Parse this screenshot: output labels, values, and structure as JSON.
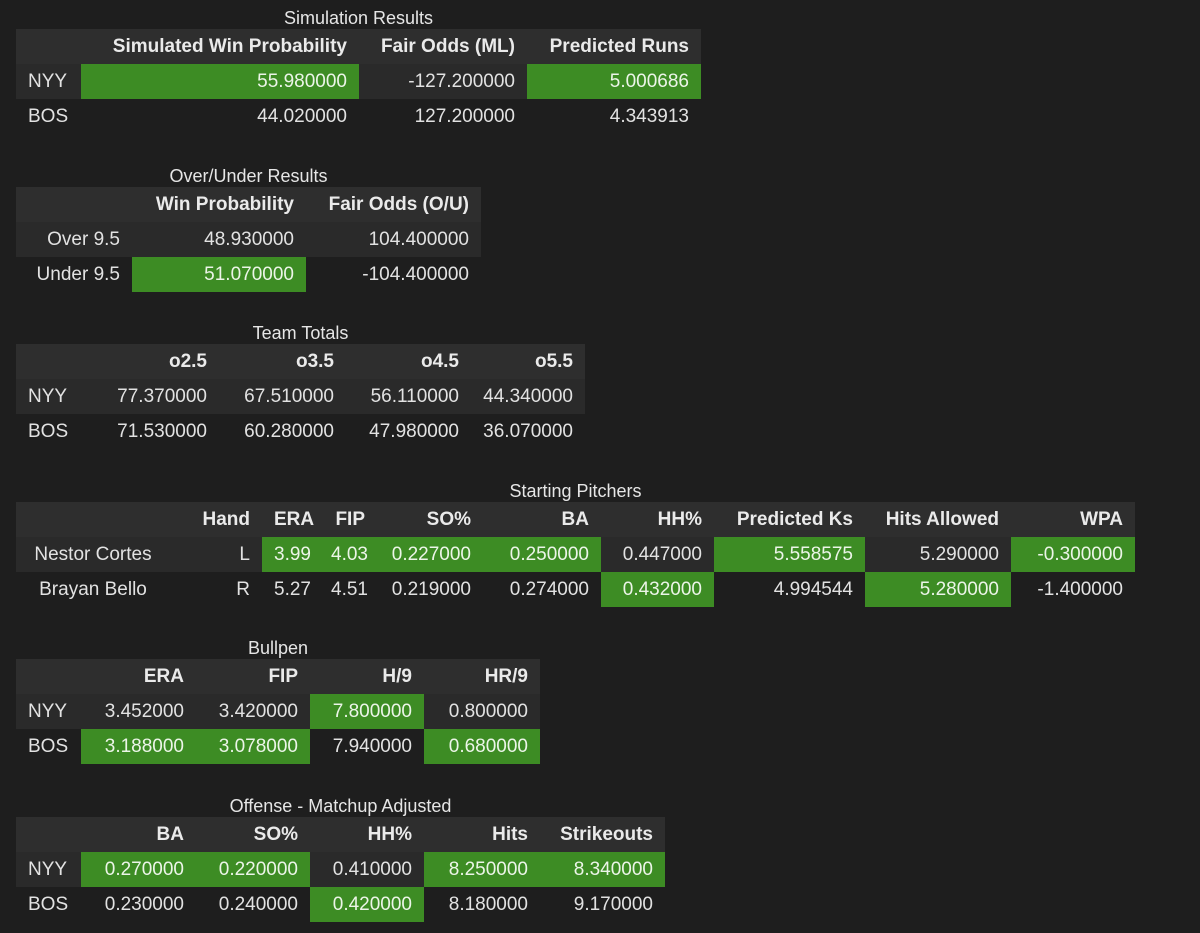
{
  "colors": {
    "background": "#1e1e1e",
    "header_bg": "#2e2e2e",
    "stripe_bg": "#2a2a2a",
    "highlight": "#3d8c24",
    "text": "#e2e2e2"
  },
  "simulation": {
    "caption": "Simulation Results",
    "headers": [
      "",
      "Simulated Win Probability",
      "Fair Odds (ML)",
      "Predicted Runs"
    ],
    "rows": [
      {
        "cells": [
          "NYY",
          "55.980000",
          "-127.200000",
          "5.000686"
        ],
        "highlight": [
          false,
          true,
          false,
          true
        ]
      },
      {
        "cells": [
          "BOS",
          "44.020000",
          "127.200000",
          "4.343913"
        ],
        "highlight": [
          false,
          false,
          false,
          false
        ]
      }
    ]
  },
  "over_under": {
    "caption": "Over/Under Results",
    "headers": [
      "",
      "Win Probability",
      "Fair Odds (O/U)"
    ],
    "rows": [
      {
        "cells": [
          "Over 9.5",
          "48.930000",
          "104.400000"
        ],
        "highlight": [
          false,
          false,
          false
        ]
      },
      {
        "cells": [
          "Under 9.5",
          "51.070000",
          "-104.400000"
        ],
        "highlight": [
          false,
          true,
          false
        ]
      }
    ]
  },
  "team_totals": {
    "caption": "Team Totals",
    "headers": [
      "",
      "o2.5",
      "o3.5",
      "o4.5",
      "o5.5"
    ],
    "rows": [
      {
        "cells": [
          "NYY",
          "77.370000",
          "67.510000",
          "56.110000",
          "44.340000"
        ],
        "highlight": [
          false,
          false,
          false,
          false,
          false
        ]
      },
      {
        "cells": [
          "BOS",
          "71.530000",
          "60.280000",
          "47.980000",
          "36.070000"
        ],
        "highlight": [
          false,
          false,
          false,
          false,
          false
        ]
      }
    ]
  },
  "starting_pitchers": {
    "caption": "Starting Pitchers",
    "headers": [
      "",
      "Hand",
      "ERA",
      "FIP",
      "SO%",
      "BA",
      "HH%",
      "Predicted Ks",
      "Hits Allowed",
      "WPA"
    ],
    "rows": [
      {
        "cells": [
          "Nestor Cortes",
          "L",
          "3.99",
          "4.03",
          "0.227000",
          "0.250000",
          "0.447000",
          "5.558575",
          "5.290000",
          "-0.300000"
        ],
        "highlight": [
          false,
          false,
          true,
          true,
          true,
          true,
          false,
          true,
          false,
          true
        ]
      },
      {
        "cells": [
          "Brayan Bello",
          "R",
          "5.27",
          "4.51",
          "0.219000",
          "0.274000",
          "0.432000",
          "4.994544",
          "5.280000",
          "-1.400000"
        ],
        "highlight": [
          false,
          false,
          false,
          false,
          false,
          false,
          true,
          false,
          true,
          false
        ]
      }
    ]
  },
  "bullpen": {
    "caption": "Bullpen",
    "headers": [
      "",
      "ERA",
      "FIP",
      "H/9",
      "HR/9"
    ],
    "rows": [
      {
        "cells": [
          "NYY",
          "3.452000",
          "3.420000",
          "7.800000",
          "0.800000"
        ],
        "highlight": [
          false,
          false,
          false,
          true,
          false
        ]
      },
      {
        "cells": [
          "BOS",
          "3.188000",
          "3.078000",
          "7.940000",
          "0.680000"
        ],
        "highlight": [
          false,
          true,
          true,
          false,
          true
        ]
      }
    ]
  },
  "offense": {
    "caption": "Offense - Matchup Adjusted",
    "headers": [
      "",
      "BA",
      "SO%",
      "HH%",
      "Hits",
      "Strikeouts"
    ],
    "rows": [
      {
        "cells": [
          "NYY",
          "0.270000",
          "0.220000",
          "0.410000",
          "8.250000",
          "8.340000"
        ],
        "highlight": [
          false,
          true,
          true,
          false,
          true,
          true
        ]
      },
      {
        "cells": [
          "BOS",
          "0.230000",
          "0.240000",
          "0.420000",
          "8.180000",
          "9.170000"
        ],
        "highlight": [
          false,
          false,
          false,
          true,
          false,
          false
        ]
      }
    ]
  }
}
